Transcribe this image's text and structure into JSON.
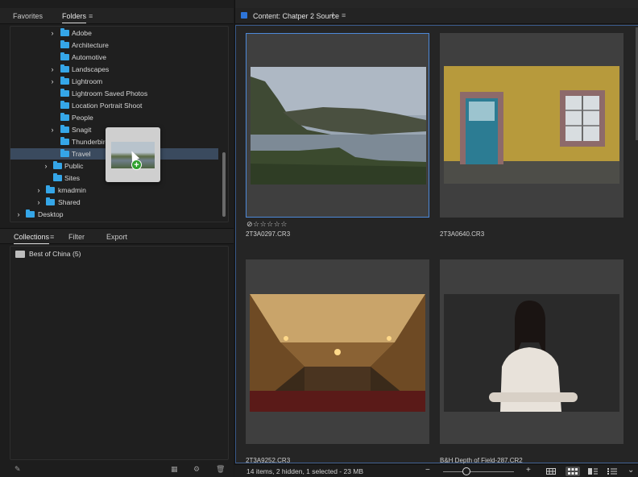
{
  "panels": {
    "top_tabs": [
      {
        "label": "Favorites"
      },
      {
        "label": "Folders"
      }
    ],
    "folders": [
      {
        "label": "Adobe",
        "chevron": "›"
      },
      {
        "label": "Architecture",
        "chevron": ""
      },
      {
        "label": "Automotive",
        "chevron": ""
      },
      {
        "label": "Landscapes",
        "chevron": "›"
      },
      {
        "label": "Lightroom",
        "chevron": "›"
      },
      {
        "label": "Lightroom Saved Photos",
        "chevron": ""
      },
      {
        "label": "Location Portrait Shoot",
        "chevron": ""
      },
      {
        "label": "People",
        "chevron": ""
      },
      {
        "label": "Snagit",
        "chevron": "›"
      },
      {
        "label": "Thunderbird",
        "chevron": ""
      },
      {
        "label": "Travel",
        "chevron": ""
      },
      {
        "label": "Public",
        "chevron": "›"
      },
      {
        "label": "Sites",
        "chevron": ""
      },
      {
        "label": "kmadmin",
        "chevron": "›"
      },
      {
        "label": "Shared",
        "chevron": "›"
      },
      {
        "label": "Desktop",
        "chevron": "›"
      }
    ],
    "collection_tabs": [
      {
        "label": "Collections"
      },
      {
        "label": "Filter"
      },
      {
        "label": "Export"
      }
    ],
    "collections": [
      {
        "label": "Best of China (5)"
      }
    ]
  },
  "content": {
    "title": "Content: Chatper 2 Source",
    "thumbnails": [
      {
        "filename": "2T3A0297.CR3",
        "rating": "⊘☆☆☆☆☆"
      },
      {
        "filename": "2T3A0640.CR3",
        "rating": ""
      },
      {
        "filename": "2T3A9252.CR3",
        "rating": ""
      },
      {
        "filename": "B&H Depth of Field-287.CR2",
        "rating": ""
      }
    ]
  },
  "status": {
    "text": "14 items, 2 hidden, 1 selected - 23 MB",
    "zoom_out": "−",
    "zoom_in": "+"
  },
  "icons": {
    "menu": "≡",
    "add": "+",
    "chevron_right": "›",
    "chevron_down": "⌄"
  },
  "colors": {
    "accent": "#2d74d8",
    "folder": "#35a6e8",
    "selection": "#3a4a5e",
    "add_badge": "#2fa02f"
  }
}
